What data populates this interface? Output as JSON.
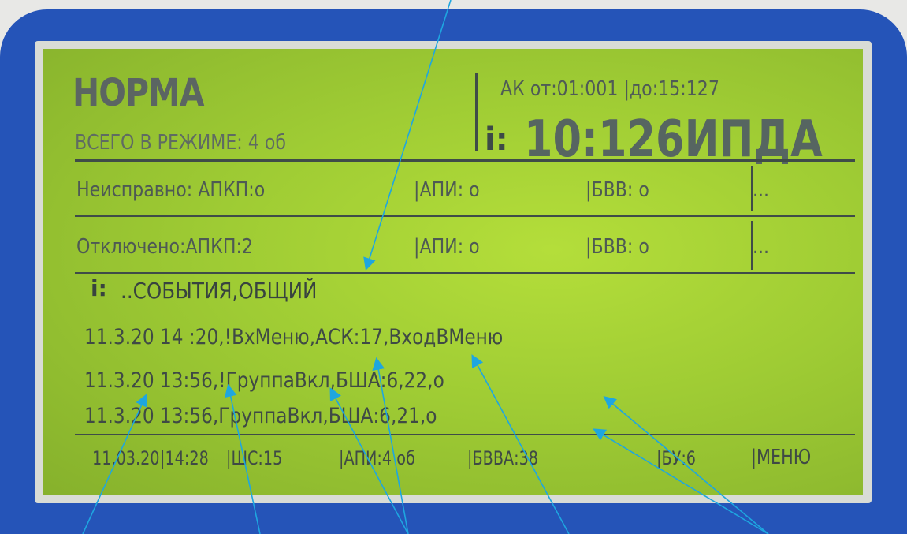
{
  "header": {
    "status": "НОРМА",
    "total_in_mode": "ВСЕГО В РЕЖИМЕ: 4 об",
    "range": "АК от:01:001 |до:15:127",
    "address": "10:126ИПДА"
  },
  "rows": {
    "faulty": {
      "label": "Неисправно: АПКП:о",
      "api": "|АПИ: о",
      "bvv": "|БВВ: о",
      "more": "..."
    },
    "disabled": {
      "label": "Отключено:АПКП:2",
      "api": "|АПИ: о",
      "bvv": "|БВВ: о",
      "more": "..."
    }
  },
  "events": {
    "title": "..СОБЫТИЯ,ОБЩИЙ",
    "items": [
      "11.3.20 14 :20,!ВхМеню,АСК:17,ВходВМеню",
      "11.3.20 13:56,!ГруппаВкл,БША:6,22,о",
      "11.3.20 13:56,ГруппаВкл,БША:6,21,о"
    ]
  },
  "footer": {
    "date": "11.03.20",
    "time": "|14:28",
    "shs": "|ШС:15",
    "api": "|АПИ:4 об",
    "bbva": "|БВВА:38",
    "bu": "|БУ:6",
    "menu": "|МЕНЮ"
  },
  "colors": {
    "bezel": "#2554b8",
    "lcd_background": "#a5d035",
    "lcd_text": "#3d4a47",
    "arrow": "#1ea6e0"
  },
  "icons": {
    "info": "info-icon"
  }
}
